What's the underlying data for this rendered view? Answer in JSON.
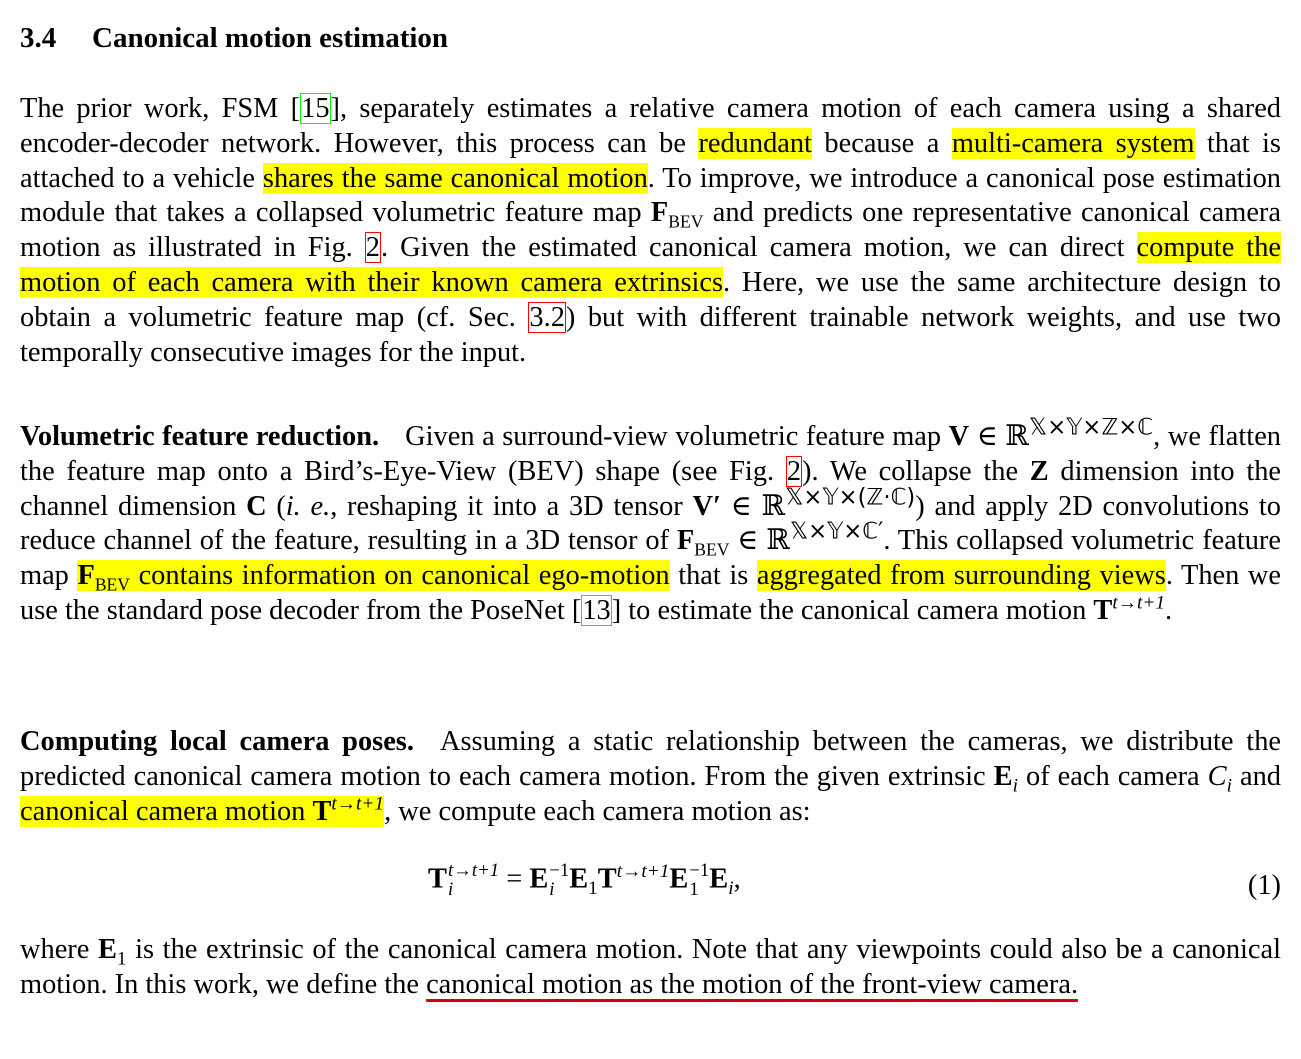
{
  "section": {
    "number": "3.4",
    "title": "Canonical motion estimation"
  },
  "paragraph1": {
    "t1": "The prior work, FSM [",
    "ref_15": "15",
    "t2": "], separately estimates a relative camera motion of each camera using a shared encoder-decoder network. However, this process can be ",
    "hl_redundant": "redundant",
    "t3": " because a ",
    "hl_multicamera": "multi-camera system",
    "t4": " that is attached to a vehicle ",
    "hl_shares": "shares the same canonical motion",
    "t5": ". To improve, we introduce a canonical pose estimation module that takes a collapsed volumetric feature map ",
    "m_F": "F",
    "m_BEV": "BEV",
    "t6": " and predicts one representative canonical camera motion as illustrated in Fig. ",
    "ref_fig2": "2",
    "t7": ". Given the estimated canonical camera motion, we can direct ",
    "hl_compute": "compute the motion of each camera with their known camera extrinsics",
    "t8": ". Here, we use the same architecture design to obtain a volumetric feature map (cf. Sec. ",
    "ref_sec32": "3.2",
    "t9": ") but with different trainable network weights, and use two temporally consecutive images for the input."
  },
  "paragraph2": {
    "runin": "Volumetric feature reduction.",
    "t1": "Given a surround-view volumetric feature map ",
    "m_V": "V",
    "m_in1": " ∈ ",
    "m_R1": "ℝ",
    "m_dims1": "𝕏×𝕐×ℤ×ℂ",
    "t2": ", we flatten the feature map onto a Bird’s-Eye-View (BEV) shape (see Fig. ",
    "ref_fig2": "2",
    "t3": "). We collapse the ",
    "m_Z": "Z",
    "t4": " dimension into the channel dimension ",
    "m_C": "C",
    "t5a": " (",
    "m_ie": "i. e.",
    "t5b": ", reshaping it into a 3D tensor ",
    "m_Vp": "V′",
    "m_in2": " ∈ ",
    "m_R2": "ℝ",
    "m_dims2": "𝕏×𝕐×(ℤ·ℂ)",
    "t6": ") and apply 2D convolutions to reduce channel of the feature, resulting in a 3D tensor of ",
    "m_F": "F",
    "m_BEV": "BEV",
    "m_in3": " ∈ ",
    "m_R3": "ℝ",
    "m_dims3": "𝕏×𝕐×ℂ′",
    "t7": ". This collapsed volumetric feature map ",
    "hl_F": "F",
    "hl_BEV": "BEV",
    "hl_contains": " contains information on canonical ego-motion",
    "t8": " that is ",
    "hl_aggregated": "aggregated from surrounding views",
    "t9": ". Then we use the standard pose decoder from the PoseNet [",
    "ref_13": "13",
    "t10": "] to estimate the canonical camera motion ",
    "m_T": "T",
    "m_tt1": "t→t+1",
    "t11": "."
  },
  "paragraph3": {
    "runin": "Computing local camera poses.",
    "t1": "Assuming a static relationship between the cameras, we distribute the predicted canonical camera motion to each camera motion. From the given extrinsic ",
    "m_E": "E",
    "m_i": "i",
    "t2": " of each camera ",
    "m_C": "C",
    "m_ci": "i",
    "t3": " and ",
    "hl_canon": "canonical camera motion ",
    "hl_T": "T",
    "hl_tt1": "t→t+1",
    "t4": ", we compute each camera motion as:"
  },
  "equation": {
    "lhs_T": "T",
    "lhs_sup": "t→t+1",
    "lhs_sub": "i",
    "eq": " = ",
    "E": "E",
    "sup_m1": "−1",
    "sub_i": "i",
    "sub_1": "1",
    "T": "T",
    "tt1": "t→t+1",
    "comma": ",",
    "number": "(1)"
  },
  "paragraph4": {
    "t1": "where ",
    "m_E": "E",
    "m_1": "1",
    "t2": " is the extrinsic of the canonical camera motion. Note that any viewpoints could also be a canonical motion. In this work, we define the ",
    "ul": "canonical motion as the motion of the front-view camera."
  },
  "colors": {
    "highlight": "#ffff00",
    "underline": "#e00000",
    "citation_box": "#00ff00",
    "crossref_box": "#ff0000"
  }
}
